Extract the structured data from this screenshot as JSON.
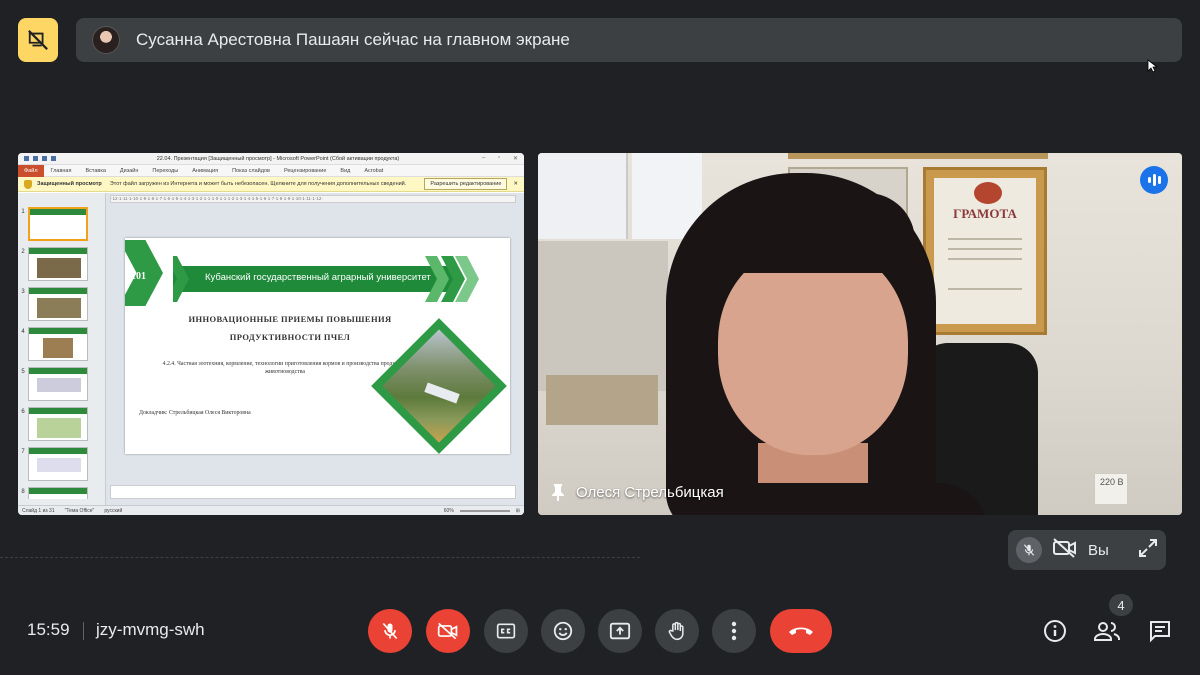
{
  "banner": {
    "presenter_text": "Сусанна Арестовна Пашаян сейчас на главном экране"
  },
  "presentation": {
    "window_title": "22.04. Презентация [Защищенный просмотр] - Microsoft PowerPoint (Сбой активации продукта)",
    "ribbon_tabs": [
      "Файл",
      "Главная",
      "Вставка",
      "Дизайн",
      "Переходы",
      "Анимация",
      "Показ слайдов",
      "Рецензирование",
      "Вид",
      "Acrobat"
    ],
    "notice": {
      "label": "Защищенный просмотр",
      "message": "Этот файл загружен из Интернета и может быть небезопасен. Щелкните для получения дополнительных сведений.",
      "button": "Разрешить редактирование"
    },
    "thumb_numbers": [
      "1",
      "2",
      "3",
      "4",
      "5",
      "6",
      "7",
      "8"
    ],
    "ruler_text": "·12·1·11·1·10·1·9·1·8·1·7·1·6·1·5·1·4·1·3·1·2·1·1·1·0·1·1·1·2·1·3·1·4·1·5·1·6·1·7·1·8·1·9·1·10·1·11·1·12·",
    "slide": {
      "logo": "101",
      "university": "Кубанский государственный аграрный университет",
      "title_line1": "ИННОВАЦИОННЫЕ   ПРИЕМЫ  ПОВЫШЕНИЯ",
      "title_line2": "ПРОДУКТИВНОСТИ  ПЧЕЛ",
      "subtitle": "4.2.4. Частная зоотехния, кормление, технологии приготовления кормов и производства продукции животноводства",
      "speaker": "Докладчик:  Стрельбицкая Олеся Викторовна"
    },
    "status": {
      "slide_info": "Слайд 1 из 31",
      "theme": "\"Тема Office\"",
      "language": "русский",
      "zoom": "60%"
    }
  },
  "video": {
    "participant_name": "Олеся Стрельбицкая",
    "certificate_title": "ГРАМОТА",
    "outlet_label": "220 В"
  },
  "self_view": {
    "label": "Вы"
  },
  "bottom_bar": {
    "time": "15:59",
    "meeting_code": "jzy-mvmg-swh",
    "participant_count": "4"
  },
  "colors": {
    "meet_bg": "#202124",
    "danger": "#ea4335",
    "accent_blue": "#1a73e8",
    "present_yellow": "#fdd663",
    "slide_green": "#1f8a3a"
  }
}
